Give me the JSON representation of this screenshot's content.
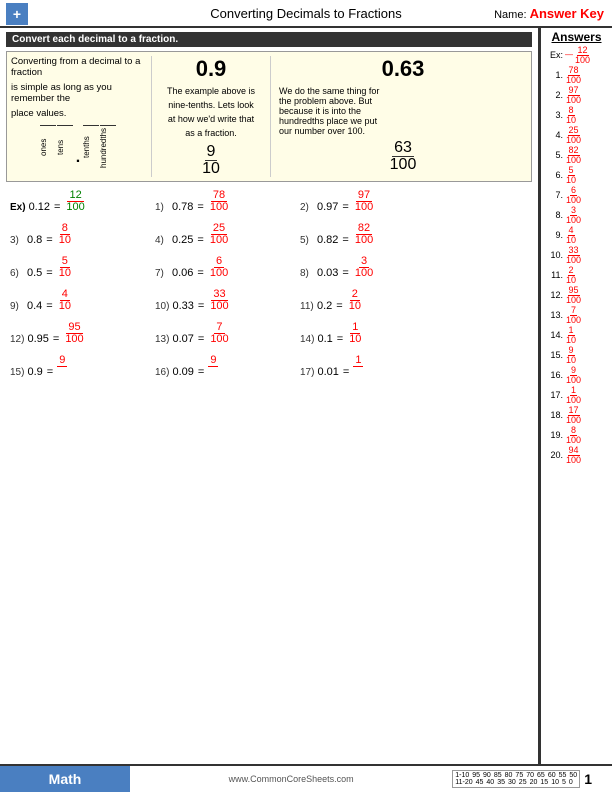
{
  "header": {
    "title": "Converting Decimals to Fractions",
    "name_label": "Name:",
    "answer_key": "Answer Key",
    "logo": "+"
  },
  "instruction": "Convert each decimal to a fraction.",
  "info_box": {
    "left_text1": "Converting from a decimal to a fraction",
    "left_text2": "is simple as long as you remember the",
    "left_text3": "place values.",
    "place_headers": [
      "ones",
      "tens",
      "tenths",
      "hundredths"
    ],
    "example1_decimal": "0.9",
    "example1_desc1": "The example above is",
    "example1_desc2": "nine-tenths. Lets look",
    "example1_desc3": "at how we'd write that",
    "example1_desc4": "as a fraction.",
    "example1_num": "9",
    "example1_den": "10",
    "example2_decimal": "0.63",
    "example2_desc1": "We do the same thing for",
    "example2_desc2": "the problem above. But",
    "example2_desc3": "because it is into the",
    "example2_desc4": "hundredths place we put",
    "example2_desc5": "our number over 100.",
    "example2_num": "63",
    "example2_den": "100"
  },
  "problems": [
    {
      "id": "Ex)",
      "decimal": "0.12",
      "num": "12",
      "den": "100"
    },
    {
      "id": "1)",
      "decimal": "0.78",
      "num": "78",
      "den": "100"
    },
    {
      "id": "2)",
      "decimal": "0.97",
      "num": "97",
      "den": "100"
    },
    {
      "id": "3)",
      "decimal": "0.8",
      "num": "8",
      "den": "10"
    },
    {
      "id": "4)",
      "decimal": "0.25",
      "num": "25",
      "den": "100"
    },
    {
      "id": "5)",
      "decimal": "0.82",
      "num": "82",
      "den": "100"
    },
    {
      "id": "6)",
      "decimal": "0.5",
      "num": "5",
      "den": "10"
    },
    {
      "id": "7)",
      "decimal": "0.06",
      "num": "6",
      "den": "100"
    },
    {
      "id": "8)",
      "decimal": "0.03",
      "num": "3",
      "den": "100"
    },
    {
      "id": "9)",
      "decimal": "0.4",
      "num": "4",
      "den": "10"
    },
    {
      "id": "10)",
      "decimal": "0.33",
      "num": "33",
      "den": "100"
    },
    {
      "id": "11)",
      "decimal": "0.2",
      "num": "2",
      "den": "10"
    },
    {
      "id": "12)",
      "decimal": "0.95",
      "num": "95",
      "den": "100"
    },
    {
      "id": "13)",
      "decimal": "0.07",
      "num": "7",
      "den": "100"
    },
    {
      "id": "14)",
      "decimal": "0.1",
      "num": "1",
      "den": "10"
    },
    {
      "id": "15)",
      "decimal": "0.9",
      "num": "9",
      "den": ""
    },
    {
      "id": "16)",
      "decimal": "0.09",
      "num": "9",
      "den": ""
    },
    {
      "id": "17)",
      "decimal": "0.01",
      "num": "1",
      "den": ""
    }
  ],
  "answers": {
    "title": "Answers",
    "ex": {
      "num": "12",
      "den": "100"
    },
    "items": [
      {
        "label": "1.",
        "num": "78",
        "den": "100"
      },
      {
        "label": "2.",
        "num": "97",
        "den": "100"
      },
      {
        "label": "3.",
        "num": "8",
        "den": "10"
      },
      {
        "label": "4.",
        "num": "25",
        "den": "100"
      },
      {
        "label": "5.",
        "num": "82",
        "den": "100"
      },
      {
        "label": "6.",
        "num": "5",
        "den": "10"
      },
      {
        "label": "7.",
        "num": "6",
        "den": "100"
      },
      {
        "label": "8.",
        "num": "3",
        "den": "100"
      },
      {
        "label": "9.",
        "num": "4",
        "den": "10"
      },
      {
        "label": "10.",
        "num": "33",
        "den": "100"
      },
      {
        "label": "11.",
        "num": "2",
        "den": "10"
      },
      {
        "label": "12.",
        "num": "95",
        "den": "100"
      },
      {
        "label": "13.",
        "num": "7",
        "den": "100"
      },
      {
        "label": "14.",
        "num": "1",
        "den": "10"
      },
      {
        "label": "15.",
        "num": "9",
        "den": "10"
      },
      {
        "label": "16.",
        "num": "9",
        "den": "100"
      },
      {
        "label": "17.",
        "num": "1",
        "den": "100"
      },
      {
        "label": "18.",
        "num": "17",
        "den": "100"
      },
      {
        "label": "19.",
        "num": "8",
        "den": "100"
      },
      {
        "label": "20.",
        "num": "94",
        "den": "100"
      }
    ]
  },
  "footer": {
    "math_label": "Math",
    "website": "www.CommonCoreSheets.com",
    "page": "1",
    "scoring_rows": [
      {
        "range": "1-10",
        "values": "95 90 85 80 75 70 65 60 55 50"
      },
      {
        "range": "11-20",
        "values": "45 40 35 30 25 20 15 10 5 0"
      }
    ]
  }
}
